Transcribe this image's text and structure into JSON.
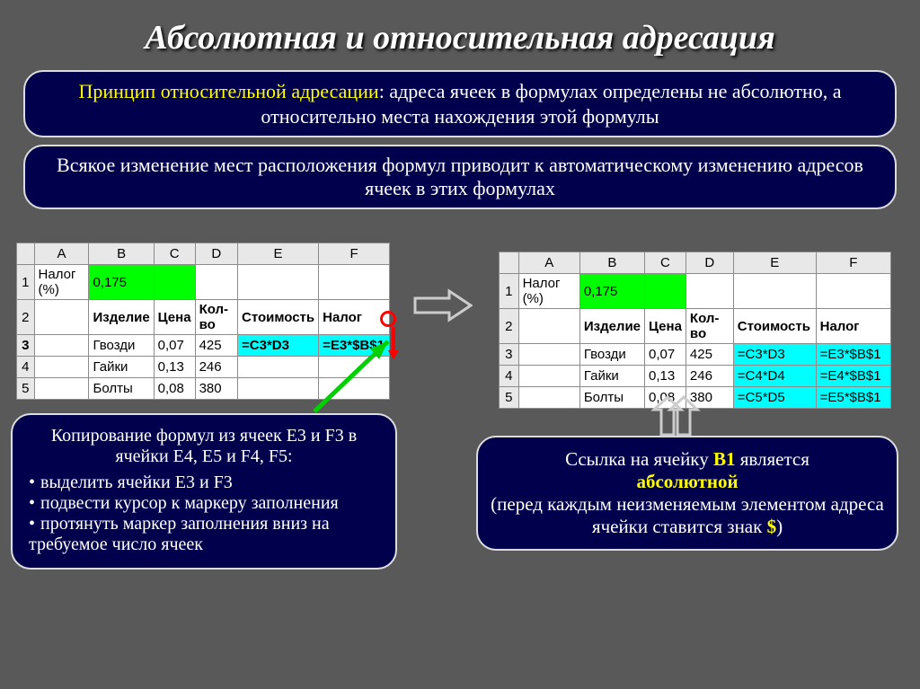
{
  "title": "Абсолютная и относительная адресация",
  "box1_prefix": "Принцип относительной адресации",
  "box1_rest": ": адреса ячеек в формулах определены не абсолютно, а относительно места нахождения этой формулы",
  "box2": "Всякое изменение мест расположения формул приводит к автоматическому изменению адресов ячеек в этих формулах",
  "sheet_left": {
    "cols": [
      "A",
      "B",
      "C",
      "D",
      "E",
      "F"
    ],
    "r1": {
      "A": "Налог (%)",
      "B": "0,175"
    },
    "r2": {
      "B": "Изделие",
      "C": "Цена",
      "D": "Кол-во",
      "E": "Стоимость",
      "F": "Налог"
    },
    "r3": {
      "B": "Гвозди",
      "C": "0,07",
      "D": "425",
      "E": "=C3*D3",
      "F": "=E3*$B$1"
    },
    "r4": {
      "B": "Гайки",
      "C": "0,13",
      "D": "246"
    },
    "r5": {
      "B": "Болты",
      "C": "0,08",
      "D": "380"
    }
  },
  "sheet_right": {
    "cols": [
      "A",
      "B",
      "C",
      "D",
      "E",
      "F"
    ],
    "r1": {
      "A": "Налог (%)",
      "B": "0,175"
    },
    "r2": {
      "B": "Изделие",
      "C": "Цена",
      "D": "Кол-во",
      "E": "Стоимость",
      "F": "Налог"
    },
    "r3": {
      "B": "Гвозди",
      "C": "0,07",
      "D": "425",
      "E": "=C3*D3",
      "F": "=E3*$B$1"
    },
    "r4": {
      "B": "Гайки",
      "C": "0,13",
      "D": "246",
      "E": "=C4*D4",
      "F": "=E4*$B$1"
    },
    "r5": {
      "B": "Болты",
      "C": "0,08",
      "D": "380",
      "E": "=C5*D5",
      "F": "=E5*$B$1"
    }
  },
  "copy": {
    "hd": "Копирование формул из ячеек E3 и F3 в ячейки E4, E5 и F4, F5:",
    "b1": "выделить ячейки E3 и F3",
    "b2": "подвести курсор к маркеру заполнения",
    "b3": "протянуть маркер заполнения вниз на требуемое число ячеек"
  },
  "ref": {
    "l1a": "Ссылка на ячейку ",
    "l1b": "B1",
    "l1c": " является",
    "l2": "абсолютной",
    "l3": "(перед каждым неизменяемым элементом адреса ячейки ставится знак ",
    "l3b": "$",
    "l3c": ")"
  }
}
